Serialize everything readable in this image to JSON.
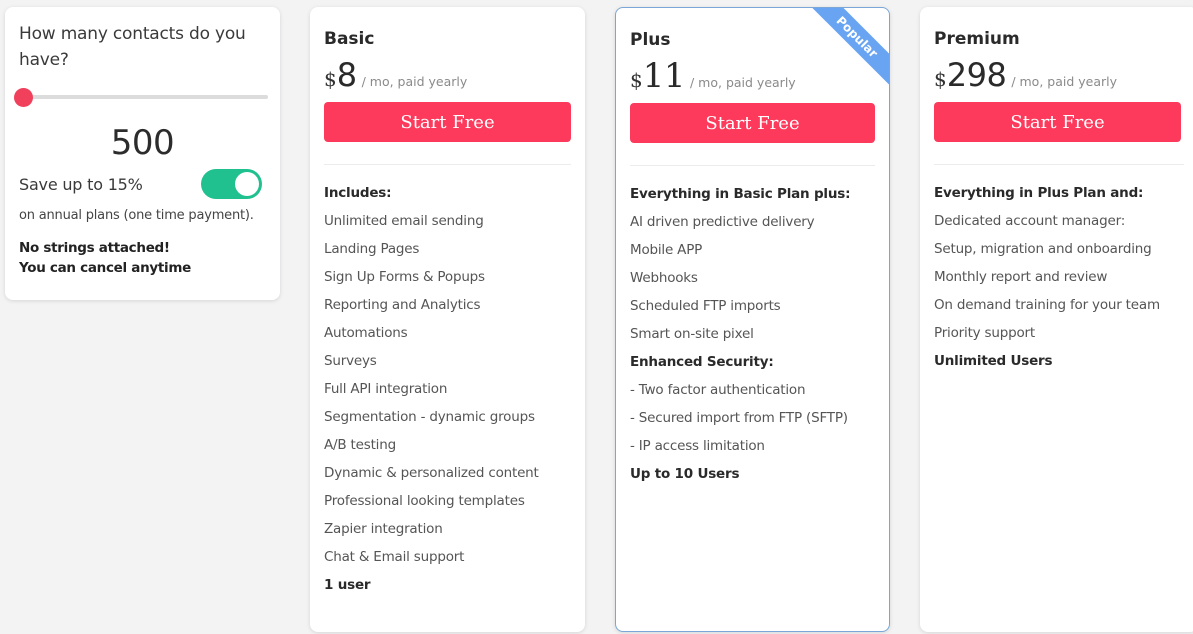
{
  "calculator": {
    "question": "How many contacts do you have?",
    "slider": {
      "value_fraction": 0.0,
      "min_label": "",
      "max_label": ""
    },
    "contacts_value": "500",
    "save_label": "Save up to 15%",
    "toggle_on": true,
    "annual_note": "on annual plans (one time payment).",
    "guarantee_line1": "No strings attached!",
    "guarantee_line2": "You can cancel anytime"
  },
  "plans": [
    {
      "name": "Basic",
      "currency": "$",
      "amount": "8",
      "period": "/ mo, paid yearly",
      "cta": "Start Free",
      "features": [
        {
          "text": "Includes:",
          "bold": true
        },
        {
          "text": "Unlimited email sending",
          "bold": false
        },
        {
          "text": "Landing Pages",
          "bold": false
        },
        {
          "text": "Sign Up Forms & Popups",
          "bold": false
        },
        {
          "text": "Reporting and Analytics",
          "bold": false
        },
        {
          "text": "Automations",
          "bold": false
        },
        {
          "text": "Surveys",
          "bold": false
        },
        {
          "text": "Full API integration",
          "bold": false
        },
        {
          "text": "Segmentation - dynamic groups",
          "bold": false
        },
        {
          "text": "A/B testing",
          "bold": false
        },
        {
          "text": "Dynamic & personalized content",
          "bold": false
        },
        {
          "text": "Professional looking templates",
          "bold": false
        },
        {
          "text": "Zapier integration",
          "bold": false
        },
        {
          "text": "Chat & Email support",
          "bold": false
        },
        {
          "text": "1 user",
          "bold": true
        }
      ]
    },
    {
      "name": "Plus",
      "badge": "Popular",
      "currency": "$",
      "amount": "11",
      "period": "/ mo, paid yearly",
      "cta": "Start Free",
      "features": [
        {
          "text": "Everything in Basic Plan plus:",
          "bold": true
        },
        {
          "text": "AI driven predictive delivery",
          "bold": false
        },
        {
          "text": "Mobile APP",
          "bold": false
        },
        {
          "text": "Webhooks",
          "bold": false
        },
        {
          "text": "Scheduled FTP imports",
          "bold": false
        },
        {
          "text": "Smart on-site pixel",
          "bold": false
        },
        {
          "text": "Enhanced Security:",
          "bold": true
        },
        {
          "text": "- Two factor authentication",
          "bold": false
        },
        {
          "text": "- Secured import from FTP (SFTP)",
          "bold": false
        },
        {
          "text": "- IP access limitation",
          "bold": false
        },
        {
          "text": "Up to 10 Users",
          "bold": true
        }
      ]
    },
    {
      "name": "Premium",
      "currency": "$",
      "amount": "298",
      "period": "/ mo, paid yearly",
      "cta": "Start Free",
      "features": [
        {
          "text": "Everything in Plus Plan and:",
          "bold": true
        },
        {
          "text": "Dedicated account manager:",
          "bold": false
        },
        {
          "text": "Setup, migration and onboarding",
          "bold": false
        },
        {
          "text": "Monthly report and review",
          "bold": false
        },
        {
          "text": "On demand training for your team",
          "bold": false
        },
        {
          "text": "Priority support",
          "bold": false
        },
        {
          "text": "Unlimited Users",
          "bold": true
        }
      ]
    }
  ],
  "colors": {
    "cta": "#fd3a5c",
    "slider_thumb": "#f0405c",
    "toggle_on": "#20c08f",
    "ribbon": "#68a4f2",
    "featured_border": "#7ba7d8"
  }
}
